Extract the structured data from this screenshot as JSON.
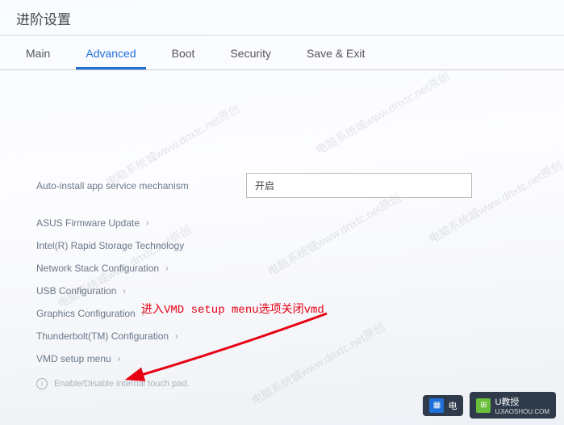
{
  "title": "进阶设置",
  "tabs": [
    {
      "label": "Main",
      "active": false
    },
    {
      "label": "Advanced",
      "active": true
    },
    {
      "label": "Boot",
      "active": false
    },
    {
      "label": "Security",
      "active": false
    },
    {
      "label": "Save & Exit",
      "active": false
    }
  ],
  "rows": {
    "auto_install": {
      "label": "Auto-install app service mechanism",
      "value": "开启"
    },
    "asus_fw": {
      "label": "ASUS Firmware Update"
    },
    "rapid_storage": {
      "label": "Intel(R) Rapid Storage Technology"
    },
    "net_stack": {
      "label": "Network Stack Configuration"
    },
    "usb": {
      "label": "USB Configuration"
    },
    "graphics": {
      "label": "Graphics Configuration"
    },
    "thunderbolt": {
      "label": "Thunderbolt(TM) Configuration"
    },
    "vmd": {
      "label": "VMD setup menu"
    }
  },
  "hint": "Enable/Disable internal touch pad.",
  "annotation": "进入VMD setup menu选项关闭vmd",
  "watermark": "电脑系统城www.dnxtc.net原创",
  "logos": {
    "left": {
      "main": "电",
      "sub": ""
    },
    "right": {
      "main": "U教授",
      "sub": "UJIAOSHOU.COM"
    }
  }
}
